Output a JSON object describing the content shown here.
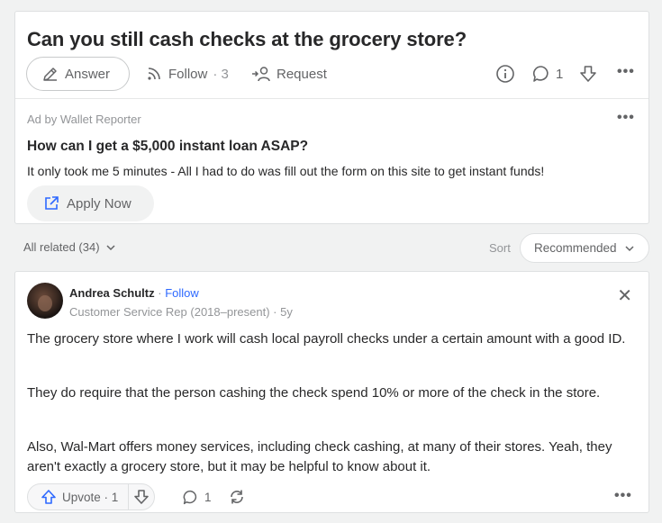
{
  "question": {
    "title": "Can you still cash checks at the grocery store?",
    "answer_label": "Answer",
    "follow_label": "Follow",
    "follow_count": "· 3",
    "request_label": "Request",
    "comment_count": "1"
  },
  "ad": {
    "by_label": "Ad by Wallet Reporter",
    "title": "How can I get a $5,000 instant loan ASAP?",
    "text": "It only took me 5 minutes - All I had to do was fill out the form on this site to get instant funds!",
    "button_label": "Apply Now"
  },
  "related_bar": {
    "label": "All related (34)",
    "sort_label": "Sort",
    "sort_value": "Recommended"
  },
  "answer": {
    "author": "Andrea Schultz",
    "follow_sep": " · ",
    "follow_link": "Follow",
    "credential": "Customer Service Rep (2018–present) · 5y",
    "paragraphs": [
      "The grocery store where I work will cash local payroll checks under a certain amount with a good ID.",
      "They do require that the person cashing the check spend 10% or more of the check in the store.",
      "Also, Wal-Mart offers money services, including check cashing, at many of their stores. Yeah, they aren't exactly a grocery store, but it may be helpful to know about it."
    ],
    "upvote_label": "Upvote · 1",
    "comment_count": "1"
  },
  "colors": {
    "background": "#f1f2f2",
    "link_blue": "#2e69ff",
    "text": "#282829",
    "muted": "#636466"
  }
}
